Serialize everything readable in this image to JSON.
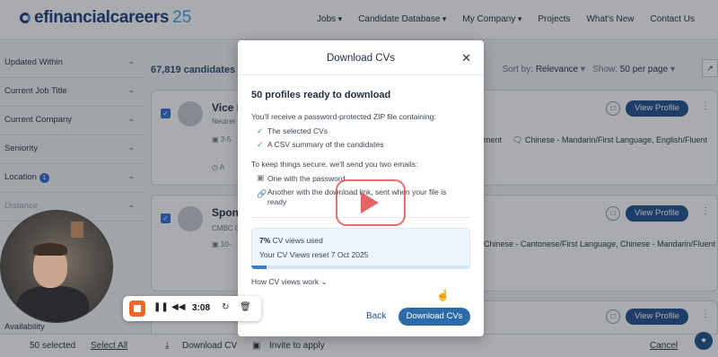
{
  "header": {
    "logo_text": "efinancialcareers",
    "logo_number": "25",
    "nav": [
      "Jobs",
      "Candidate Database",
      "My Company",
      "Projects",
      "What's New",
      "Contact Us"
    ]
  },
  "sidebar": {
    "filters": [
      "Updated Within",
      "Current Job Title",
      "Current Company",
      "Seniority",
      "Location",
      "Distance",
      "Availability"
    ],
    "location_badge": "1"
  },
  "results": {
    "count_label": "67,819 candidates fo",
    "sort_by_label": "Sort by:",
    "sort_by_value": "Relevance",
    "show_label": "Show:",
    "show_value": "50 per page",
    "cards": [
      {
        "title": "Vice P",
        "subtitle": "Neutrel",
        "meta": "3-5",
        "language_partial": "ment",
        "languages": "Chinese - Mandarin/First Language, English/Fluent",
        "view_label": "View Profile"
      },
      {
        "title": "Spons",
        "subtitle": "CMBC C",
        "meta": "10-",
        "language_partial": "",
        "languages": "Chinese - Cantonese/First Language, Chinese - Mandarin/Fluent",
        "view_label": "View Profile"
      },
      {
        "title": "",
        "subtitle": "",
        "meta": "",
        "language_partial": "",
        "languages": "",
        "view_label": "View Profile"
      }
    ]
  },
  "bottom_bar": {
    "selected": "50 selected",
    "select_all": "Select All",
    "download": "Download CV",
    "invite": "Invite to apply",
    "cancel": "Cancel"
  },
  "modal": {
    "title": "Download CVs",
    "heading": "50 profiles ready to download",
    "intro": "You'll receive a password-protected ZIP file containing:",
    "contents": [
      "The selected CVs",
      "A CSV summary of the candidates"
    ],
    "security_intro": "To keep things secure, we'll send you two emails:",
    "email_1": "One with the password",
    "email_2_line1": "Another with the download link, sent when your file is",
    "email_2_line2": "ready",
    "usage_percent": "7%",
    "usage_label": " CV views used",
    "usage_fraction": 0.07,
    "reset_text": "Your CV Views reset 7 Oct 2025",
    "how_link": "How CV views work",
    "back_label": "Back",
    "download_label": "Download CVs"
  },
  "recorder": {
    "time": "3:08"
  },
  "colors": {
    "primary": "#1e4f8a",
    "accent": "#46a0e0",
    "record": "#ee6a2a",
    "check": "#4a9b4f"
  }
}
